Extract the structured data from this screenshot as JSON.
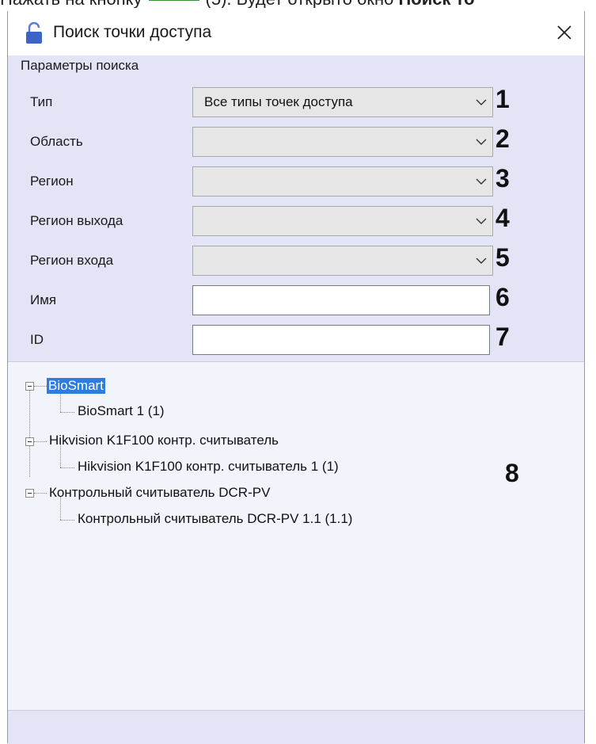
{
  "top_text": {
    "prefix": "Нажать на кнопку",
    "middle": "(5). Будет открыто окно",
    "bold": "Поиск то"
  },
  "window": {
    "title": "Поиск точки доступа"
  },
  "params": {
    "group_label": "Параметры поиска",
    "rows": [
      {
        "label": "Тип",
        "value": "Все типы точек доступа",
        "kind": "combo",
        "num": "1"
      },
      {
        "label": "Область",
        "value": "",
        "kind": "combo",
        "num": "2"
      },
      {
        "label": "Регион",
        "value": "",
        "kind": "combo",
        "num": "3"
      },
      {
        "label": "Регион выхода",
        "value": "",
        "kind": "combo",
        "num": "4"
      },
      {
        "label": "Регион входа",
        "value": "",
        "kind": "combo",
        "num": "5"
      },
      {
        "label": "Имя",
        "value": "",
        "kind": "text",
        "num": "6"
      },
      {
        "label": "ID",
        "value": "",
        "kind": "text",
        "num": "7"
      }
    ]
  },
  "tree": {
    "nodes": [
      {
        "label": "BioSmart",
        "selected": true
      },
      {
        "label": "BioSmart 1 (1)"
      },
      {
        "label": "Hikvision K1F100 контр. считыватель"
      },
      {
        "label": "Hikvision K1F100 контр. считыватель 1 (1)"
      },
      {
        "label": "Контрольный считыватель DCR-PV"
      },
      {
        "label": "Контрольный считыватель DCR-PV 1.1 (1.1)"
      }
    ],
    "num": "8"
  },
  "colors": {
    "selection": "#2b7de0",
    "panel": "#e3e4f5",
    "tree_bg": "#f1f4fb"
  }
}
